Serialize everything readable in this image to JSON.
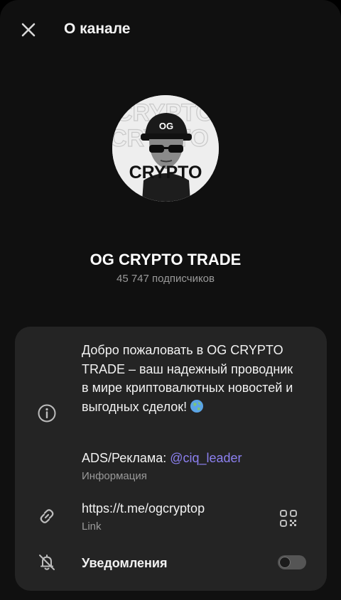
{
  "header": {
    "title": "О канале",
    "close_icon": "close-icon"
  },
  "channel": {
    "avatar_text_top": "OG",
    "avatar_text_main": "CRYPTO",
    "name": "OG CRYPTO TRADE",
    "subscribers": "45 747 подписчиков"
  },
  "info": {
    "icon": "info-icon",
    "description": "Добро пожаловать в OG CRYPTO TRADE – ваш надежный проводник в мире криптовалютных новостей и выгодных сделок!",
    "description_emoji": "globe-icon",
    "ads_label": "ADS/Реклама: ",
    "ads_handle": "@ciq_leader",
    "ads_sublabel": "Информация"
  },
  "link": {
    "icon": "link-icon",
    "url": "https://t.me/ogcryptop",
    "sublabel": "Link",
    "qr_icon": "qr-code-icon"
  },
  "notifications": {
    "icon": "bell-off-icon",
    "label": "Уведомления",
    "enabled": false
  },
  "colors": {
    "background": "#101010",
    "card": "#242424",
    "accent_link": "#8c80f0",
    "secondary_text": "#9a9a9a"
  }
}
